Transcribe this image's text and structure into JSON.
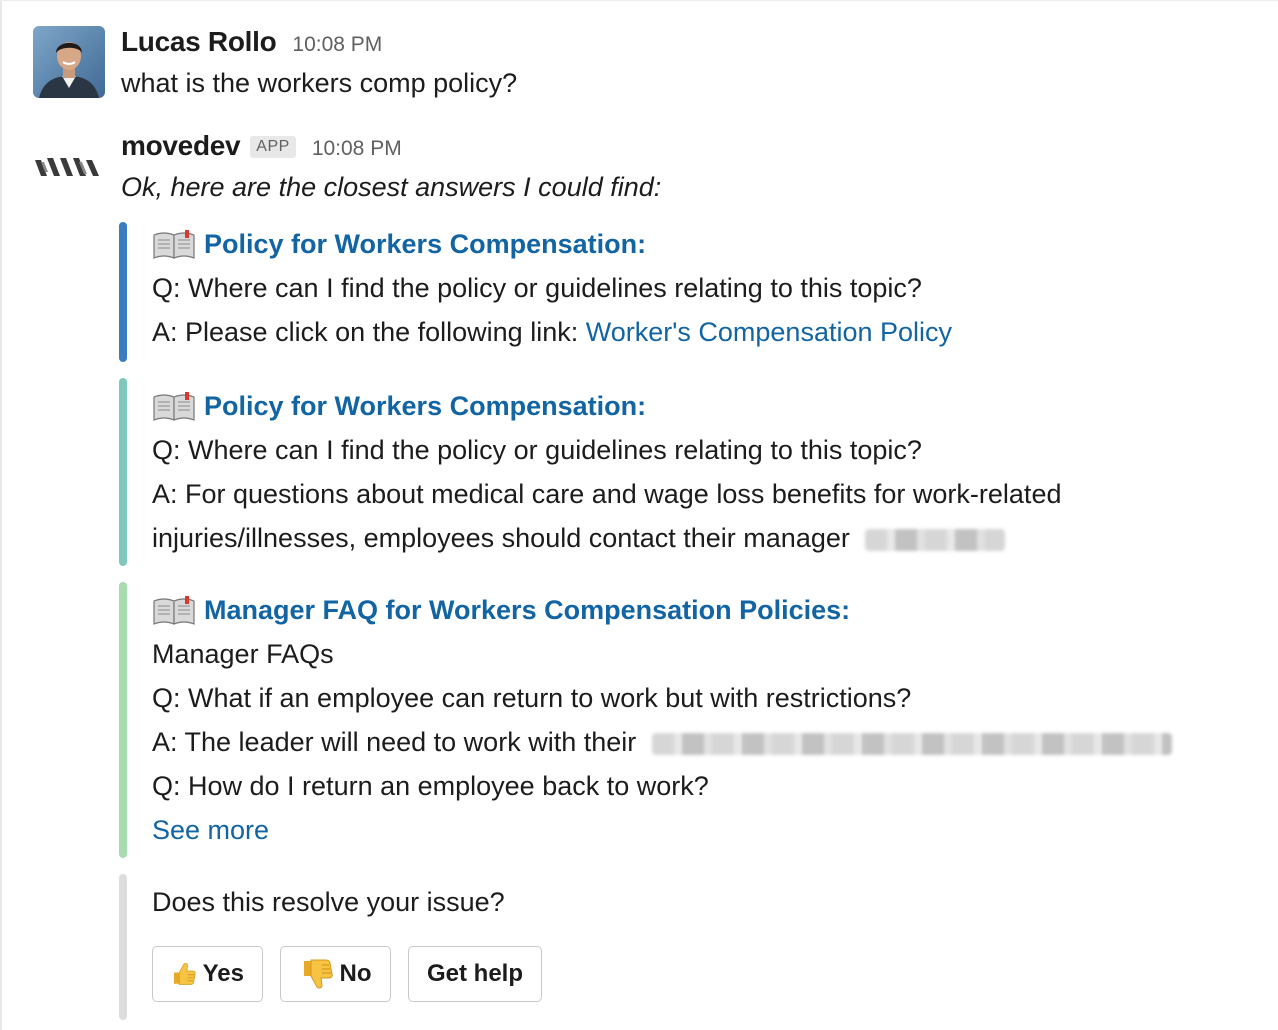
{
  "messages": {
    "user": {
      "name": "Lucas Rollo",
      "time": "10:08 PM",
      "text": "what is the workers comp policy?"
    },
    "bot": {
      "name": "movedev",
      "badge": "APP",
      "time": "10:08 PM",
      "intro": "Ok, here are the closest answers I could find:"
    }
  },
  "answers": [
    {
      "bar_color": "#3a7cc0",
      "title": "Policy for Workers Compensation:",
      "q": "Q: Where can I find the policy or guidelines relating to this topic?",
      "a_prefix": "A: Please click on the following link: ",
      "a_link": "Worker's Compensation Policy"
    },
    {
      "bar_color": "#7fc9bc",
      "title": "Policy for Workers Compensation:",
      "q": "Q: Where can I find the policy or guidelines relating to this topic?",
      "a_line1": "A: For questions about medical care and wage loss benefits for work-related",
      "a_line2": "injuries/illnesses, employees should contact their manager"
    },
    {
      "bar_color": "#a6dcb0",
      "title": "Manager FAQ for Workers Compensation Policies:",
      "line1": "Manager FAQs",
      "line2": "Q: What if an employee can return to work but with restrictions?",
      "line3": "A: The leader will need to work with their",
      "line4": "Q: How do I return an employee back to work?",
      "see_more": "See more"
    }
  ],
  "feedback": {
    "bar_color": "#dddddd",
    "question": "Does this resolve your issue?",
    "buttons": {
      "yes": "Yes",
      "no": "No",
      "help": "Get help"
    }
  },
  "icons": {
    "book": "open-book-icon",
    "thumbs_up": "thumbs-up-icon",
    "thumbs_down": "thumbs-down-icon"
  }
}
